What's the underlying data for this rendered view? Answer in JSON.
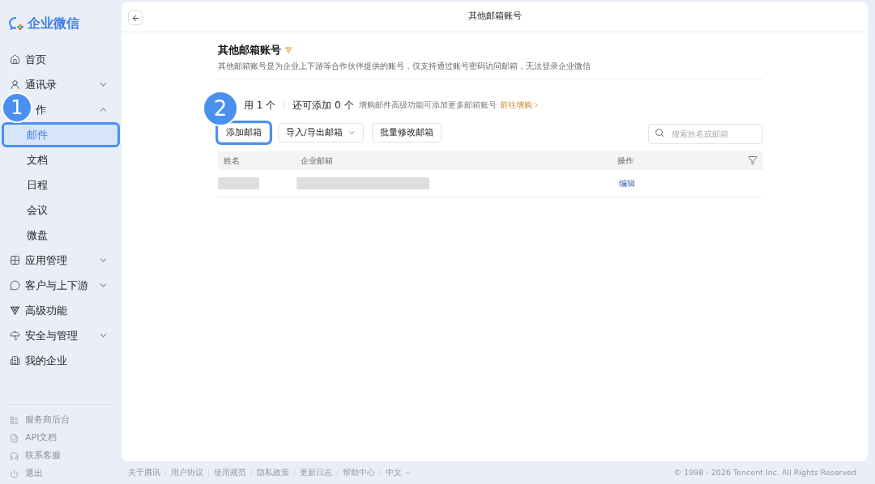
{
  "logo": {
    "text": "企业微信"
  },
  "nav": [
    {
      "kind": "link",
      "label": "首页"
    },
    {
      "kind": "group",
      "label": "通讯录",
      "expanded": false
    },
    {
      "kind": "group",
      "label": "作",
      "expanded": true,
      "children": [
        {
          "label": "邮件",
          "selected": true,
          "highlighted": true
        },
        {
          "label": "文档",
          "selected": false,
          "highlighted": false
        },
        {
          "label": "日程",
          "selected": false,
          "highlighted": false
        },
        {
          "label": "会议",
          "selected": false,
          "highlighted": false
        },
        {
          "label": "微盘",
          "selected": false,
          "highlighted": false
        }
      ]
    },
    {
      "kind": "group",
      "label": "应用管理",
      "expanded": false
    },
    {
      "kind": "group",
      "label": "客户与上下游",
      "expanded": false
    },
    {
      "kind": "link",
      "label": "高级功能"
    },
    {
      "kind": "group",
      "label": "安全与管理",
      "expanded": false
    },
    {
      "kind": "link",
      "label": "我的企业"
    }
  ],
  "bottom_links": [
    "服务商后台",
    "API文档",
    "联系客服",
    "退出"
  ],
  "callouts": [
    {
      "text": "1"
    },
    {
      "text": "2"
    }
  ],
  "page": {
    "title": "其他邮箱账号",
    "heading": "其他邮箱账号",
    "description": "其他邮箱账号是为企业上下游等合作伙伴提供的账号，仅支持通过账号密码访问邮箱，无法登录企业微信",
    "stats": {
      "used": "用 1 个",
      "available": "还可添加 0 个",
      "hint": "增购邮件高级功能可添加更多邮箱账号",
      "link": "前往增购"
    },
    "buttons": [
      {
        "label": "添加邮箱",
        "dropdown": false,
        "highlighted": true
      },
      {
        "label": "导入/导出邮箱",
        "dropdown": true,
        "highlighted": false
      },
      {
        "label": "批量修改邮箱",
        "dropdown": false,
        "highlighted": false
      }
    ],
    "search": {
      "placeholder": "搜索姓名或邮箱"
    },
    "table": {
      "columns": [
        "姓名",
        "企业邮箱",
        "操作"
      ],
      "rows": [
        {
          "action": "编辑"
        }
      ]
    }
  },
  "footer": {
    "links": [
      "关于腾讯",
      "用户协议",
      "使用规范",
      "隐私政策",
      "更新日志",
      "帮助中心"
    ],
    "language": "中文",
    "copyright": "© 1998 - 2026 Tencent Inc. All Rights Reserved"
  }
}
